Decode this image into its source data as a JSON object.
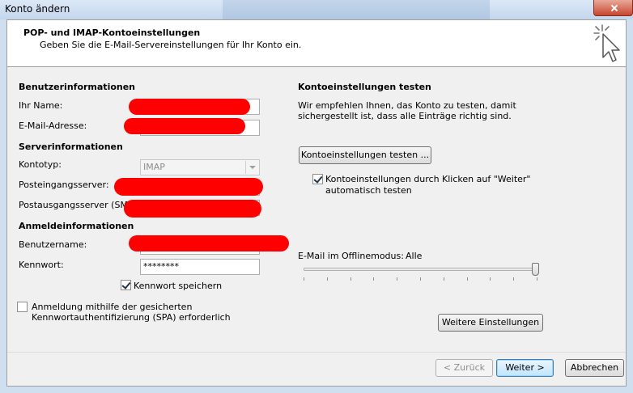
{
  "window": {
    "title": "Konto ändern"
  },
  "header": {
    "title": "POP- und IMAP-Kontoeinstellungen",
    "subtitle": "Geben Sie die E-Mail-Servereinstellungen für Ihr Konto ein.",
    "icon": "cursor-sparkle-icon"
  },
  "left": {
    "user_section": "Benutzerinformationen",
    "name_label": "Ihr Name:",
    "email_label": "E-Mail-Adresse:",
    "server_section": "Serverinformationen",
    "type_label": "Kontotyp:",
    "type_value": "IMAP",
    "incoming_label": "Posteingangsserver:",
    "outgoing_label": "Postausgangsserver (SMTP):",
    "login_section": "Anmeldeinformationen",
    "username_label": "Benutzername:",
    "password_label": "Kennwort:",
    "password_value": "********",
    "remember_label": "Kennwort speichern",
    "remember_checked": true,
    "spa_line1": "Anmeldung mithilfe der gesicherten",
    "spa_line2": "Kennwortauthentifizierung (SPA) erforderlich",
    "spa_checked": false
  },
  "right": {
    "test_section": "Kontoeinstellungen testen",
    "test_desc1": "Wir empfehlen Ihnen, das Konto zu testen, damit",
    "test_desc2": "sichergestellt ist, dass alle Einträge richtig sind.",
    "test_button": "Kontoeinstellungen testen ...",
    "auto_test_line1": "Kontoeinstellungen durch Klicken auf \"Weiter\"",
    "auto_test_line2": "automatisch testen",
    "auto_test_checked": true,
    "offline_label": "E-Mail im Offlinemodus:",
    "offline_value": "Alle",
    "offline_slider_level": 1.0,
    "more_settings_button": "Weitere Einstellungen"
  },
  "footer": {
    "back_button": "< Zurück",
    "next_button": "Weiter >",
    "cancel_button": "Abbrechen"
  },
  "colors": {
    "redaction": "#ff0000",
    "accent": "#3c7fb1"
  }
}
